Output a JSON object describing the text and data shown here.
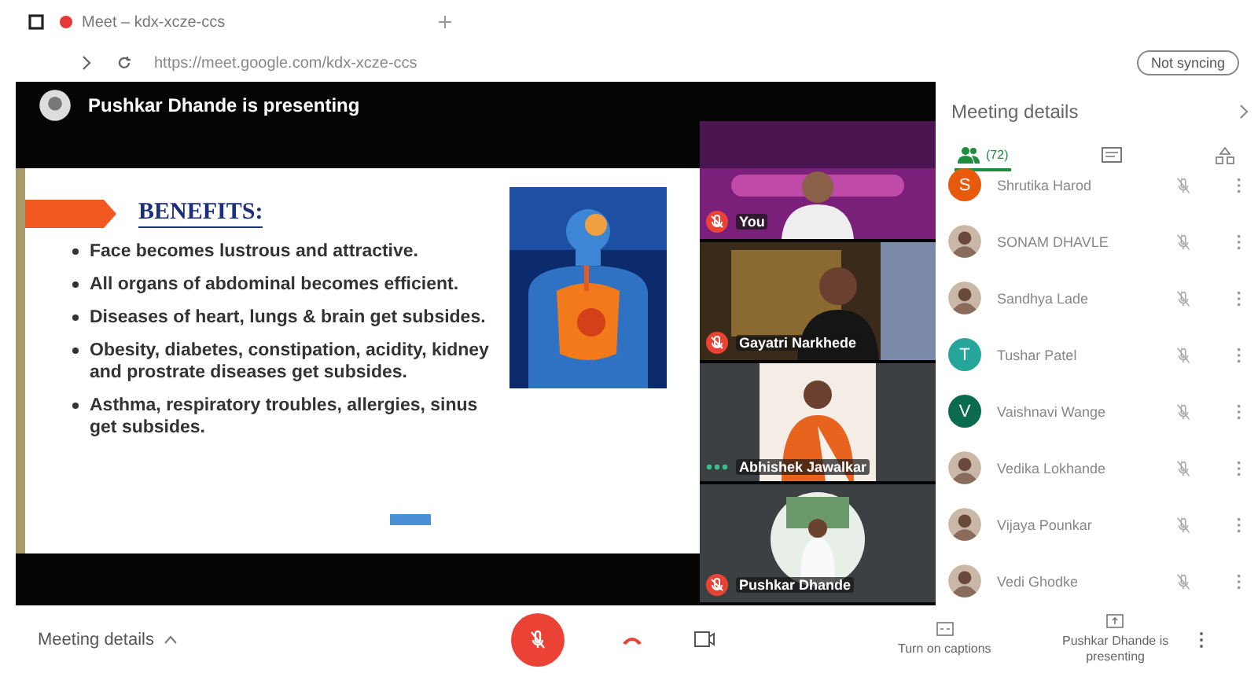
{
  "browser": {
    "tab_title": "Meet – kdx-xcze-ccs",
    "address": "https://meet.google.com/kdx-xcze-ccs",
    "profile_button": "Not syncing"
  },
  "presentation": {
    "banner": "Pushkar Dhande is presenting",
    "slide": {
      "heading": "BENEFITS:",
      "bullets": [
        "Face becomes lustrous and attractive.",
        "All organs of abdominal becomes efficient.",
        "Diseases of heart, lungs & brain get subsides.",
        "Obesity, diabetes, constipation, acidity, kidney and prostrate diseases get subsides.",
        "Asthma, respiratory troubles, allergies, sinus get subsides."
      ]
    }
  },
  "tiles": [
    {
      "name": "You",
      "muted": true
    },
    {
      "name": "Gayatri Narkhede",
      "muted": true
    },
    {
      "name": "Abhishek Jawalkar",
      "muted": false
    },
    {
      "name": "Pushkar Dhande",
      "muted": true
    }
  ],
  "panel": {
    "title": "Meeting details",
    "tabs": [
      {
        "kind": "people",
        "label": "(72)",
        "selected": true
      },
      {
        "kind": "chat",
        "selected": false
      },
      {
        "kind": "activities",
        "selected": false
      }
    ],
    "participants": [
      {
        "name": "Shrutika Harod",
        "kind": "letter",
        "letter": "S",
        "color": "#e8590c"
      },
      {
        "name": "SONAM DHAVLE"
      },
      {
        "name": "Sandhya Lade"
      },
      {
        "name": "Tushar Patel",
        "kind": "letter",
        "letter": "T",
        "color": "#26a69a"
      },
      {
        "name": "Vaishnavi Wange",
        "kind": "letter",
        "letter": "V",
        "color": "#0b6b4f"
      },
      {
        "name": "Vedika Lokhande"
      },
      {
        "name": "Vijaya Pounkar"
      },
      {
        "name": "Vedi Ghodke"
      }
    ]
  },
  "controls": {
    "details": "Meeting details",
    "mic_muted": true,
    "captions": "Turn on captions",
    "presenting": "Pushkar Dhande is presenting"
  }
}
